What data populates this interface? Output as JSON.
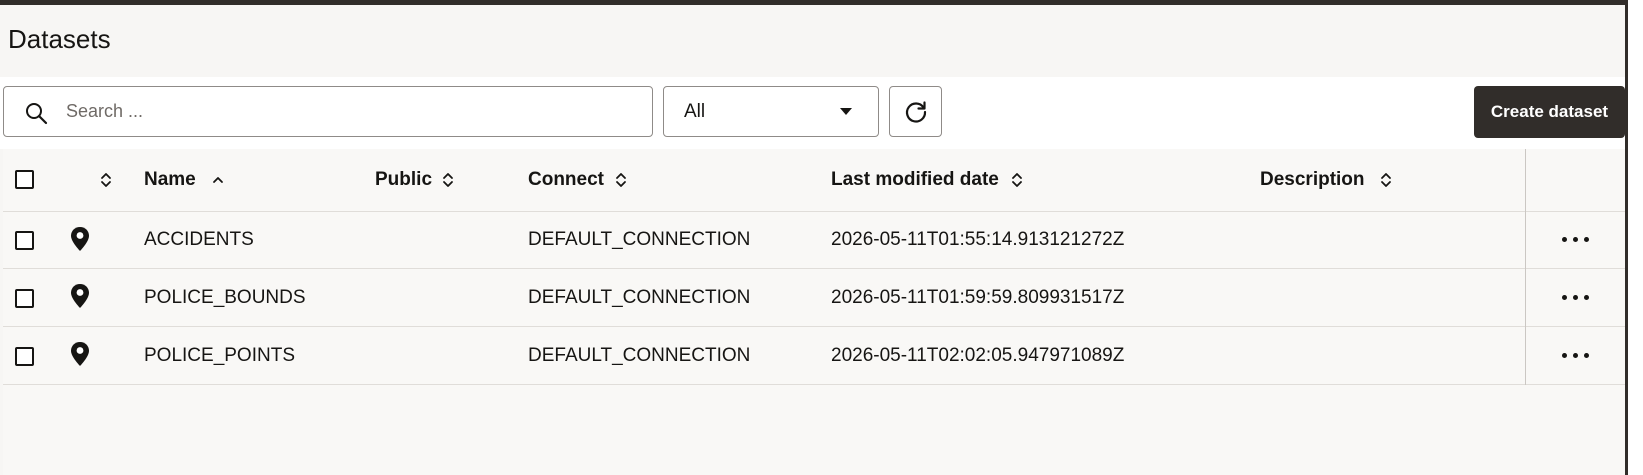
{
  "page": {
    "title": "Datasets"
  },
  "toolbar": {
    "search_placeholder": "Search ...",
    "filter_value": "All",
    "create_label": "Create dataset"
  },
  "table": {
    "headers": {
      "name": "Name",
      "public": "Public",
      "connect": "Connect",
      "last_modified": "Last modified date",
      "description": "Description"
    },
    "sort": {
      "column": "name",
      "direction": "ascending"
    },
    "rows": [
      {
        "icon": "map-pin-icon",
        "name": "ACCIDENTS",
        "public": "",
        "connect": "DEFAULT_CONNECTION",
        "last_modified": "2026-05-11T01:55:14.913121272Z",
        "description": ""
      },
      {
        "icon": "map-pin-icon",
        "name": "POLICE_BOUNDS",
        "public": "",
        "connect": "DEFAULT_CONNECTION",
        "last_modified": "2026-05-11T01:59:59.809931517Z",
        "description": ""
      },
      {
        "icon": "map-pin-icon",
        "name": "POLICE_POINTS",
        "public": "",
        "connect": "DEFAULT_CONNECTION",
        "last_modified": "2026-05-11T02:02:05.947971089Z",
        "description": ""
      }
    ]
  },
  "colors": {
    "primary_button": "#312d2a",
    "background": "#f7f6f4",
    "border": "#8f8b88"
  }
}
